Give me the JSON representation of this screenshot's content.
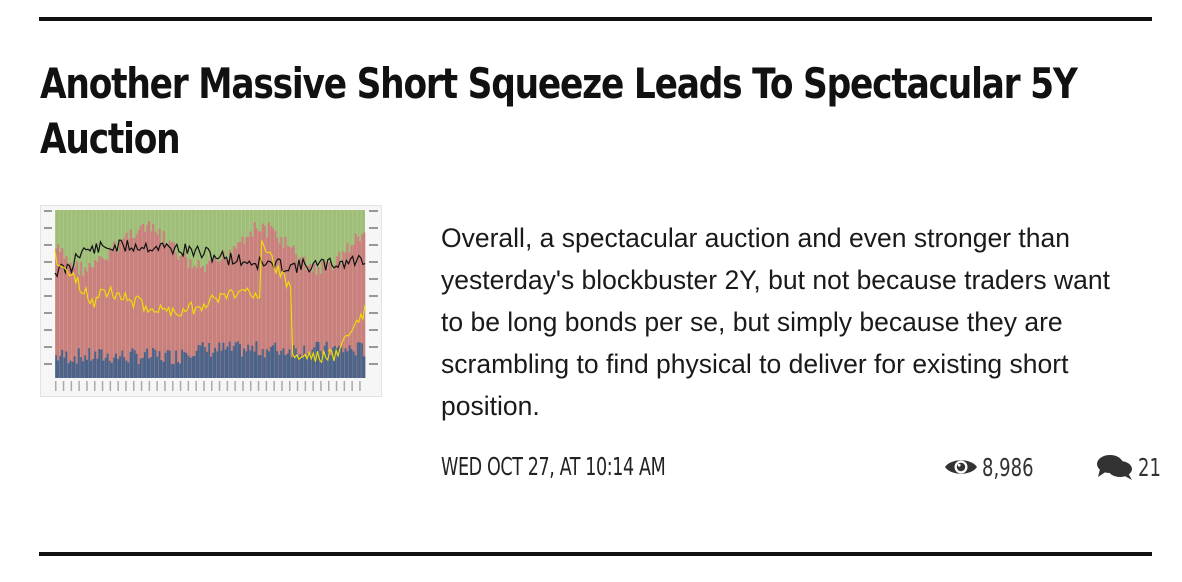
{
  "article": {
    "title": "Another Massive Short Squeeze Leads To Spectacular 5Y Auction",
    "excerpt": "Overall, a spectacular auction and even stronger than yesterday's blockbuster 2Y, but not because traders want to be long bonds per se, but simply because they are scrambling to find physical to deliver for existing short position.",
    "date": "WED OCT 27, AT 10:14 AM",
    "views": "8,986",
    "comments": "21",
    "thumbnail": {
      "description_colors": {
        "green": "#9fbf78",
        "red": "#c9807c",
        "blue": "#4a6288",
        "black_line": "#111111",
        "yellow_line": "#f2e000"
      }
    }
  },
  "icons": {
    "views": "eye-icon",
    "comments": "comments-icon"
  }
}
